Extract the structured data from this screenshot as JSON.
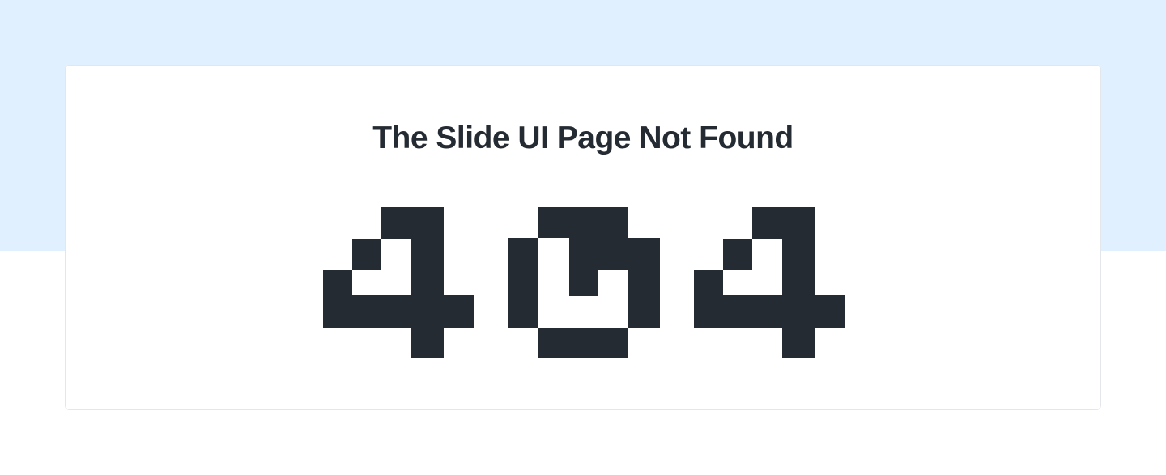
{
  "page": {
    "title": "The Slide UI Page Not Found",
    "error_code": "404"
  },
  "colors": {
    "top_band": "#e0f0fe",
    "card_background": "#ffffff",
    "card_border": "#e3e6ea",
    "text": "#252b32",
    "pixel_fill": "#252b32"
  }
}
